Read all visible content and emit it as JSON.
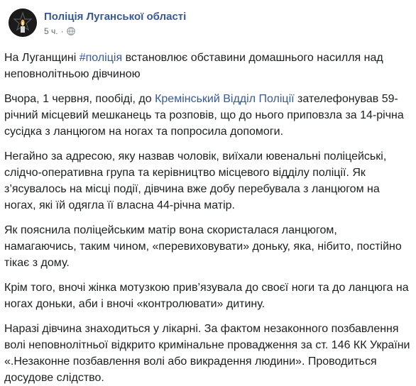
{
  "post": {
    "author": "Поліція Луганської області",
    "time": "5 ч.",
    "separator": "·",
    "privacy_icon": "globe-icon",
    "avatar_icon": "police-badge-icon",
    "paragraphs": [
      {
        "p1_before": "На Луганщині ",
        "p1_hashtag": "#поліція",
        "p1_after": " встановлює обставини домашнього насилля над неповнолітньою дівчиною"
      },
      {
        "p2_before": "Вчора, 1 червня, пообіді, до ",
        "p2_link": "Кремінський Відділ Поліції",
        "p2_after": " зателефонував 59-річний місцевий мешканець та розповів, що до нього приповзла за 14-річна сусідка з ланцюгом на ногах та попросила допомоги."
      },
      {
        "p3_text": "Негайно за адресою, яку назвав чоловік, виїхали ювенальні поліцейські, слідчо-оперативна група та керівництво місцевого відділу поліції. Як з’ясувалось на місці події, дівчина вже добу перебувала з ланцюгом на ногах, які їй одягла її власна 44-річна матір."
      },
      {
        "p4_text": "Як пояснила поліцейським матір вона скористалася ланцюгом, намагаючись, таким чином, «перевиховувати» доньку, яка, нібито, постійно тікає з дому."
      },
      {
        "p5_text": "Крім того, вночі жінка мотузкою прив’язувала до своєї ноги та до ланцюга на ногах доньки, аби і вночі «контролювати» дитину."
      },
      {
        "p6_text": "Наразі дівчина знаходиться у лікарні. За фактом незаконного позбавлення волі неповнолітньої відкрито кримінальне провадження за ст. 146 КК України «.Незаконне позбавлення волі або викрадення людини». Проводиться досудове слідство."
      }
    ]
  },
  "colors": {
    "link": "#385898",
    "text": "#1c1e21",
    "meta": "#606770"
  }
}
